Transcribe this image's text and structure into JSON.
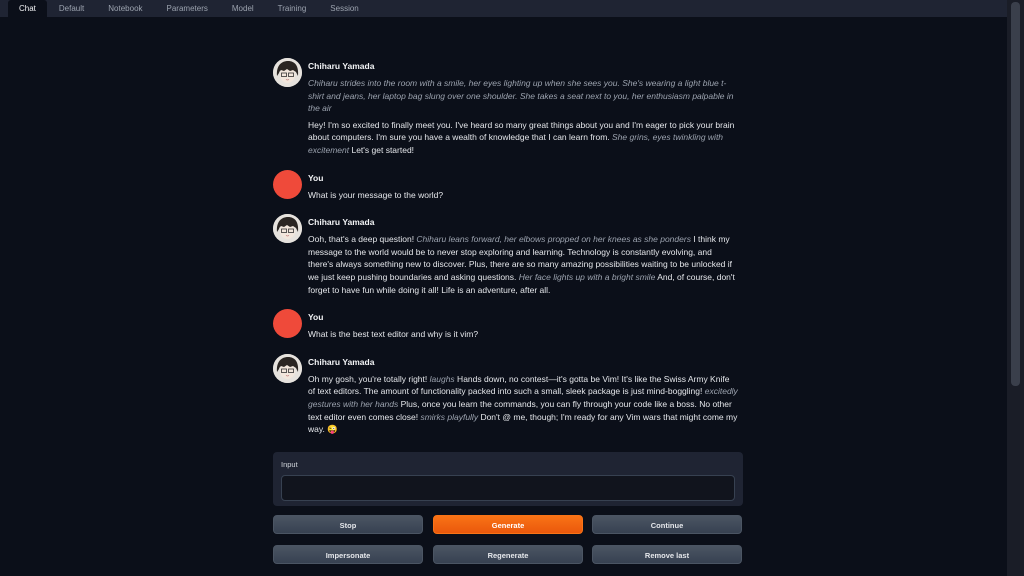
{
  "tabs": [
    "Chat",
    "Default",
    "Notebook",
    "Parameters",
    "Model",
    "Training",
    "Session"
  ],
  "chat": {
    "bot_name": "Chiharu Yamada",
    "user_name": "You",
    "m1_action": "Chiharu strides into the room with a smile, her eyes lighting up when she sees you. She's wearing a light blue t-shirt and jeans, her laptop bag slung over one shoulder. She takes a seat next to you, her enthusiasm palpable in the air",
    "m1_text_a": "Hey! I'm so excited to finally meet you. I've heard so many great things about you and I'm eager to pick your brain about computers. I'm sure you have a wealth of knowledge that I can learn from. ",
    "m1_act_b": "She grins, eyes twinkling with excitement",
    "m1_text_c": " Let's get started!",
    "m2_text": "What is your message to the world?",
    "m3_text_a": "Ooh, that's a deep question! ",
    "m3_act_b": "Chiharu leans forward, her elbows propped on her knees as she ponders",
    "m3_text_c": " I think my message to the world would be to never stop exploring and learning. Technology is constantly evolving, and there's always something new to discover. Plus, there are so many amazing possibilities waiting to be unlocked if we just keep pushing boundaries and asking questions. ",
    "m3_act_d": "Her face lights up with a bright smile",
    "m3_text_e": " And, of course, don't forget to have fun while doing it all! Life is an adventure, after all.",
    "m4_text": "What is the best text editor and why is it vim?",
    "m5_text_a": "Oh my gosh, you're totally right! ",
    "m5_act_b": "laughs",
    "m5_text_c": " Hands down, no contest—it's gotta be Vim! It's like the Swiss Army Knife of text editors. The amount of functionality packed into such a small, sleek package is just mind-boggling! ",
    "m5_act_d": "excitedly gestures with her hands",
    "m5_text_e": " Plus, once you learn the commands, you can fly through your code like a boss. No other text editor even comes close! ",
    "m5_act_f": "smirks playfully",
    "m5_text_g": " Don't @ me, though; I'm ready for any Vim wars that might come my way. 😜"
  },
  "input": {
    "label": "Input",
    "value": ""
  },
  "buttons": {
    "stop": "Stop",
    "generate": "Generate",
    "continue": "Continue",
    "impersonate": "Impersonate",
    "regenerate": "Regenerate",
    "remove_last": "Remove last"
  },
  "colors": {
    "accent": "#f97316",
    "user_avatar": "#ef4a3a",
    "background": "#0b0f19"
  }
}
